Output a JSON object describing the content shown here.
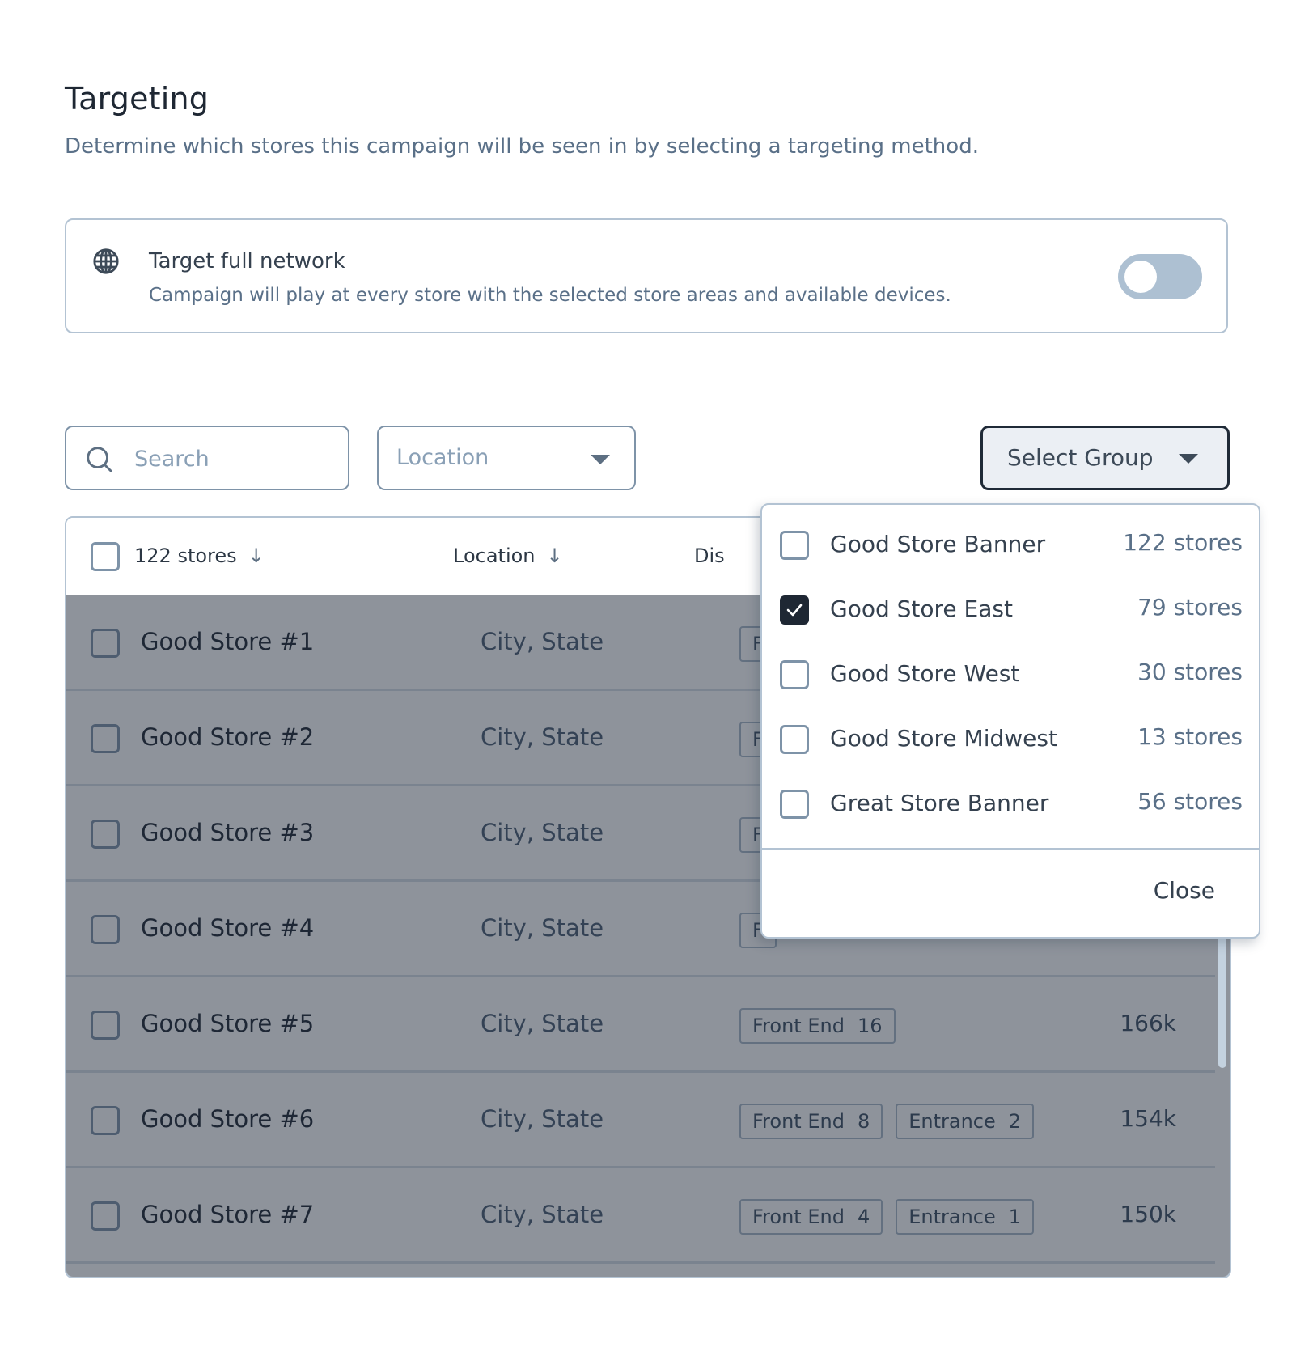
{
  "header": {
    "title": "Targeting",
    "subtitle": "Determine which stores this campaign will be seen in by selecting a targeting method."
  },
  "network_card": {
    "icon": "globe-icon",
    "title": "Target full network",
    "description": "Campaign will play at every store with the selected store areas and available devices.",
    "toggle_on": false
  },
  "filters": {
    "search_placeholder": "Search",
    "search_value": "",
    "location_placeholder": "Location",
    "group_button_label": "Select Group"
  },
  "table": {
    "columns": {
      "stores": "122 stores",
      "location": "Location",
      "display": "Dis"
    },
    "rows": [
      {
        "name": "Good Store #1",
        "location": "City, State",
        "tags": [
          {
            "label": "F",
            "count": ""
          }
        ],
        "traffic": ""
      },
      {
        "name": "Good Store #2",
        "location": "City, State",
        "tags": [
          {
            "label": "F",
            "count": ""
          }
        ],
        "traffic": ""
      },
      {
        "name": "Good Store #3",
        "location": "City, State",
        "tags": [
          {
            "label": "F",
            "count": ""
          }
        ],
        "traffic": ""
      },
      {
        "name": "Good Store #4",
        "location": "City, State",
        "tags": [
          {
            "label": "F",
            "count": ""
          }
        ],
        "traffic": ""
      },
      {
        "name": "Good Store #5",
        "location": "City, State",
        "tags": [
          {
            "label": "Front End",
            "count": "16"
          }
        ],
        "traffic": "166k"
      },
      {
        "name": "Good Store #6",
        "location": "City, State",
        "tags": [
          {
            "label": "Front End",
            "count": "8"
          },
          {
            "label": "Entrance",
            "count": "2"
          }
        ],
        "traffic": "154k"
      },
      {
        "name": "Good Store #7",
        "location": "City, State",
        "tags": [
          {
            "label": "Front End",
            "count": "4"
          },
          {
            "label": "Entrance",
            "count": "1"
          }
        ],
        "traffic": "150k"
      }
    ]
  },
  "group_menu": {
    "items": [
      {
        "label": "Good Store Banner",
        "count": "122 stores",
        "checked": false
      },
      {
        "label": "Good Store East",
        "count": "79 stores",
        "checked": true
      },
      {
        "label": "Good Store West",
        "count": "30 stores",
        "checked": false
      },
      {
        "label": "Good Store Midwest",
        "count": "13 stores",
        "checked": false
      },
      {
        "label": "Great Store Banner",
        "count": "56 stores",
        "checked": false
      }
    ],
    "close_label": "Close"
  },
  "colors": {
    "accent_dark": "#1e2733",
    "border": "#b3c3d3",
    "muted_text": "#5a7088",
    "toggle_off": "#adc0d2"
  }
}
